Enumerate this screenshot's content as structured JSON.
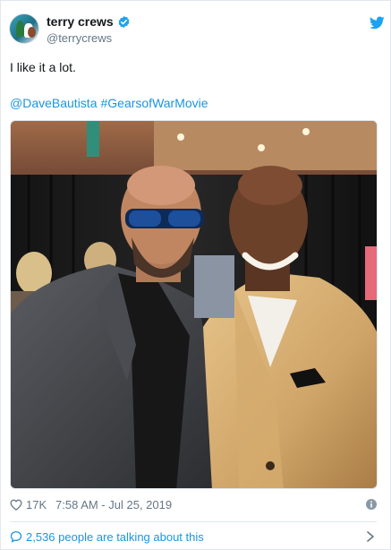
{
  "author": {
    "name": "terry crews",
    "handle": "@terrycrews",
    "avatar_icon": "profile-avatar"
  },
  "tweet": {
    "text": "I like it a lot.",
    "mentions": [
      "@DaveBautista",
      "#GearsofWarMovie"
    ]
  },
  "meta": {
    "likes": "17K",
    "timestamp": "7:58 AM - Jul 25, 2019"
  },
  "footer": {
    "talking": "2,536 people are talking about this"
  },
  "colors": {
    "link": "#1b95e0",
    "muted": "#657786",
    "verified": "#1da1f2",
    "twitter_blue": "#1da1f2"
  }
}
